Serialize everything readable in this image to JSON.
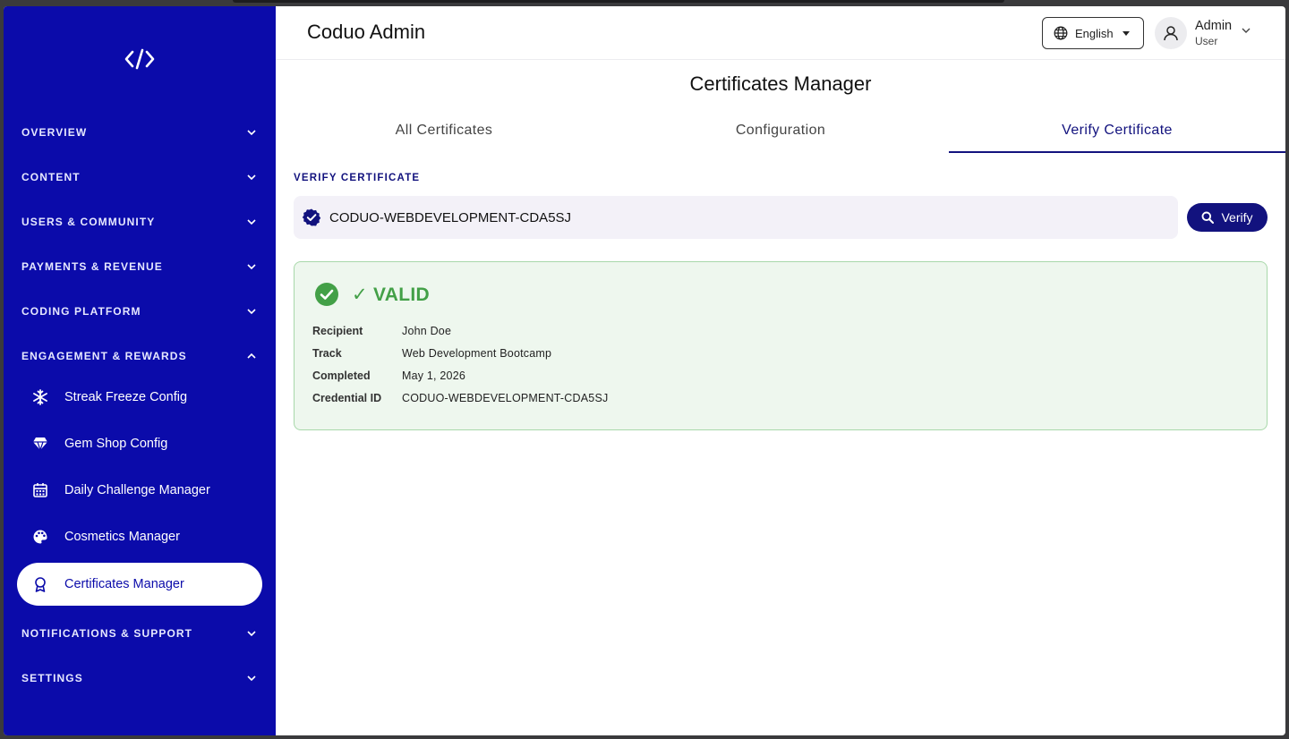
{
  "app": {
    "title": "Coduo Admin"
  },
  "header": {
    "language": "English",
    "user_name": "Admin",
    "user_role": "User"
  },
  "sidebar": {
    "sections": [
      {
        "label": "OVERVIEW",
        "expanded": false
      },
      {
        "label": "CONTENT",
        "expanded": false
      },
      {
        "label": "USERS & COMMUNITY",
        "expanded": false
      },
      {
        "label": "PAYMENTS & REVENUE",
        "expanded": false
      },
      {
        "label": "CODING PLATFORM",
        "expanded": false
      },
      {
        "label": "ENGAGEMENT & REWARDS",
        "expanded": true
      },
      {
        "label": "NOTIFICATIONS & SUPPORT",
        "expanded": false
      },
      {
        "label": "SETTINGS",
        "expanded": false
      }
    ],
    "items": [
      {
        "label": "Streak Freeze Config",
        "icon": "snowflake-icon"
      },
      {
        "label": "Gem Shop Config",
        "icon": "gem-icon"
      },
      {
        "label": "Daily Challenge Manager",
        "icon": "calendar-icon"
      },
      {
        "label": "Cosmetics Manager",
        "icon": "palette-icon"
      },
      {
        "label": "Certificates Manager",
        "icon": "award-icon",
        "active": true
      }
    ]
  },
  "page": {
    "title": "Certificates Manager",
    "tabs": [
      {
        "label": "All Certificates"
      },
      {
        "label": "Configuration"
      },
      {
        "label": "Verify Certificate",
        "active": true
      }
    ]
  },
  "verify": {
    "section_label": "VERIFY CERTIFICATE",
    "input_value": "CODUO-WEBDEVELOPMENT-CDA5SJ",
    "button_label": "Verify"
  },
  "result": {
    "status": "✓ VALID",
    "fields": [
      {
        "key": "Recipient",
        "value": "John Doe"
      },
      {
        "key": "Track",
        "value": "Web Development Bootcamp"
      },
      {
        "key": "Completed",
        "value": "May 1, 2026"
      },
      {
        "key": "Credential ID",
        "value": "CODUO-WEBDEVELOPMENT-CDA5SJ"
      }
    ]
  },
  "colors": {
    "sidebar_bg": "#0b0baa",
    "accent": "#12127e",
    "valid_green": "#43a047",
    "result_bg": "#eef7ee"
  }
}
